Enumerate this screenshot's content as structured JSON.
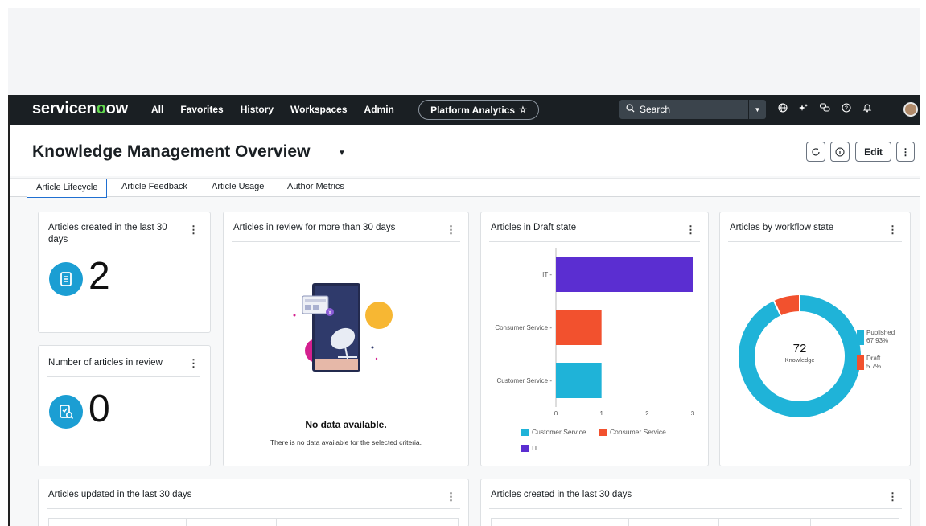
{
  "top_strip_text": "",
  "nav": {
    "logo_service": "servicen",
    "logo_now": "ow",
    "links": [
      "All",
      "Favorites",
      "History",
      "Workspaces",
      "Admin"
    ],
    "context_pill": "Platform Analytics",
    "search_placeholder": "Search",
    "icons": [
      "globe-icon",
      "sparkle-icon",
      "chat-icon",
      "help-icon",
      "bell-icon"
    ]
  },
  "page": {
    "title": "Knowledge Management Overview",
    "edit_label": "Edit"
  },
  "tabs": [
    "Article Lifecycle",
    "Article Feedback",
    "Article Usage",
    "Author Metrics"
  ],
  "cards": {
    "created_30": {
      "title": "Articles created in the last 30 days",
      "value": "2"
    },
    "in_review": {
      "title": "Number of articles in review",
      "value": "0"
    },
    "review_30": {
      "title": "Articles in review for more than 30 days",
      "nodata_title": "No data available.",
      "nodata_sub": "There is no data available for the selected criteria."
    },
    "draft": {
      "title": "Articles in Draft state"
    },
    "workflow": {
      "title": "Articles by workflow state"
    },
    "updated_30": {
      "title": "Articles updated in the last 30 days"
    },
    "created_30_bottom": {
      "title": "Articles created in the last 30 days"
    }
  },
  "chart_data": [
    {
      "type": "bar",
      "orientation": "horizontal",
      "title": "Articles in Draft state",
      "categories": [
        "IT",
        "Consumer Service",
        "Customer Service"
      ],
      "values": [
        3,
        1,
        1
      ],
      "colors": [
        "#5b2ed1",
        "#f2512e",
        "#1fb3d8"
      ],
      "x_ticks": [
        "0",
        "1",
        "2",
        "3"
      ],
      "xlim": [
        0,
        3
      ],
      "legend": [
        "Customer Service",
        "Consumer Service",
        "IT"
      ],
      "legend_position": "bottom"
    },
    {
      "type": "pie",
      "variant": "donut",
      "title": "Articles by workflow state",
      "center_value": "72",
      "center_label": "Knowledge",
      "slices": [
        {
          "name": "Published",
          "value": 67,
          "percent_label": "67  93%",
          "color": "#1fb3d8"
        },
        {
          "name": "Draft",
          "value": 5,
          "percent_label": "5  7%",
          "color": "#f2512e"
        }
      ],
      "legend_position": "right"
    }
  ]
}
